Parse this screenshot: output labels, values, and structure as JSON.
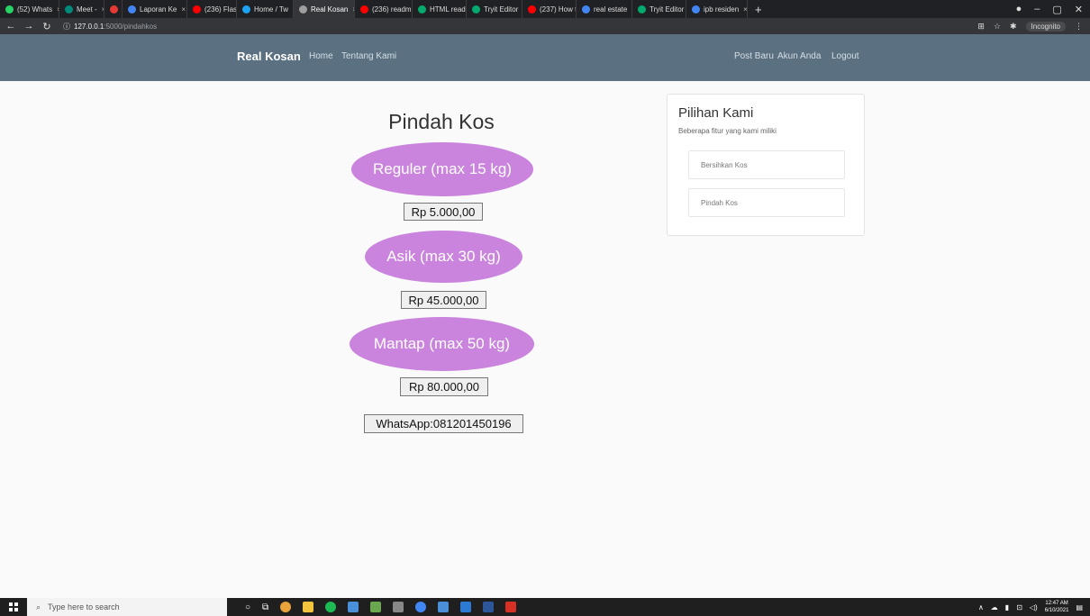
{
  "browser": {
    "tabs": [
      {
        "title": "(52) Whats",
        "color": "#25d366"
      },
      {
        "title": "Meet -",
        "color": "#00897b"
      },
      {
        "title": "",
        "color": "#e53935"
      },
      {
        "title": "Laporan Ke",
        "color": "#4285f4"
      },
      {
        "title": "(236) Flask",
        "color": "#ff0000"
      },
      {
        "title": "Home / Tw",
        "color": "#1da1f2"
      },
      {
        "title": "Real Kosan",
        "color": "#9e9e9e",
        "active": true
      },
      {
        "title": "(236) readm",
        "color": "#ff0000"
      },
      {
        "title": "HTML read",
        "color": "#04aa6d"
      },
      {
        "title": "Tryit Editor",
        "color": "#04aa6d"
      },
      {
        "title": "(237) How t",
        "color": "#ff0000"
      },
      {
        "title": "real estate",
        "color": "#4285f4"
      },
      {
        "title": "Tryit Editor",
        "color": "#04aa6d"
      },
      {
        "title": "ipb residen",
        "color": "#4285f4"
      }
    ],
    "url_host": "127.0.0.1",
    "url_path": ":5000/pindahkos",
    "incognito_label": "Incognito"
  },
  "navbar": {
    "brand": "Real Kosan",
    "home": "Home",
    "about": "Tentang Kami",
    "post": "Post Baru",
    "account": "Akun Anda",
    "logout": "Logout",
    "background": "#5b7181"
  },
  "main": {
    "title": "Pindah Kos",
    "packages": [
      {
        "label": "Reguler (max 15 kg)",
        "price": "Rp 5.000,00"
      },
      {
        "label": "Asik (max 30 kg)",
        "price": "Rp 45.000,00"
      },
      {
        "label": "Mantap (max 50 kg)",
        "price": "Rp 80.000,00"
      }
    ],
    "whatsapp": "WhatsApp:081201450196",
    "accent": "#ca84de"
  },
  "sidebar": {
    "title": "Pilihan Kami",
    "subtitle": "Beberapa fitur yang kami miliki",
    "items": [
      "Bersihkan Kos",
      "Pindah Kos"
    ]
  },
  "taskbar": {
    "search_placeholder": "Type here to search",
    "time": "12:47 AM",
    "date": "6/10/2021"
  }
}
